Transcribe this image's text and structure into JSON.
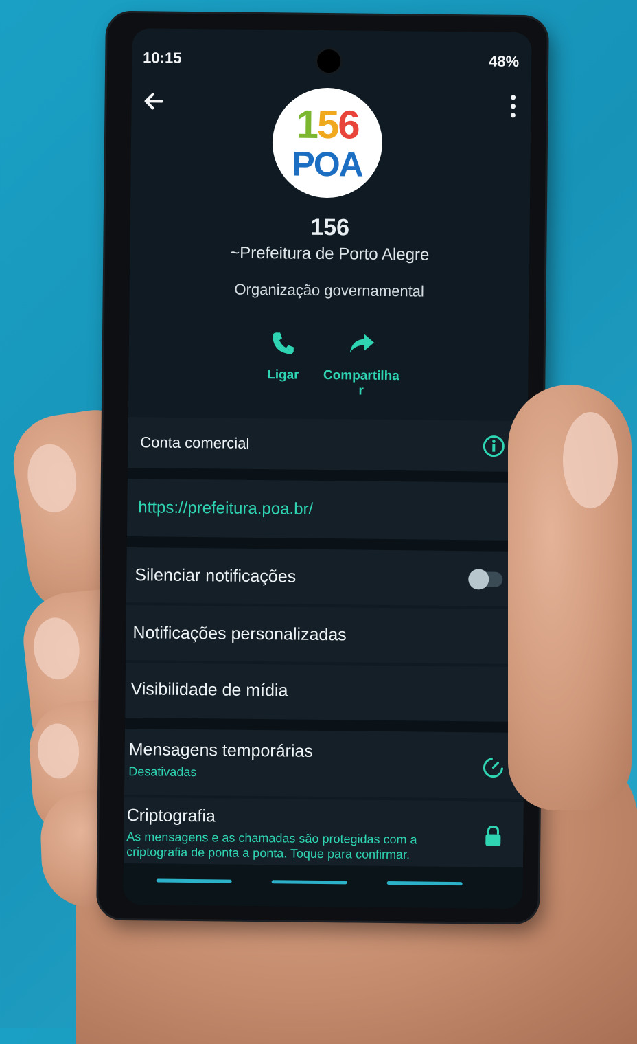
{
  "status_bar": {
    "time": "10:15",
    "indicators": "48%"
  },
  "profile": {
    "logo_line1": "156",
    "logo_line2": "POA",
    "name": "156",
    "subtitle": "~Prefeitura de Porto Alegre",
    "category": "Organização governamental"
  },
  "actions": [
    {
      "label": "Ligar",
      "icon": "phone-icon"
    },
    {
      "label": "Compartilha\nr",
      "icon": "share-icon"
    }
  ],
  "rows": {
    "business": "Conta comercial",
    "website": "https://prefeitura.poa.br/",
    "mute": "Silenciar notificações",
    "custom_notifications": "Notificações personalizadas",
    "media_visibility": "Visibilidade de mídia",
    "disappearing": "Mensagens temporárias",
    "disappearing_status": "Desativadas",
    "encryption": "Criptografia",
    "encryption_desc": "As mensagens e as chamadas são protegidas com a criptografia de ponta a ponta. Toque para confirmar."
  },
  "colors": {
    "accent": "#2fd5b3",
    "background": "#1aa0c4",
    "screen": "#0f1a22"
  }
}
